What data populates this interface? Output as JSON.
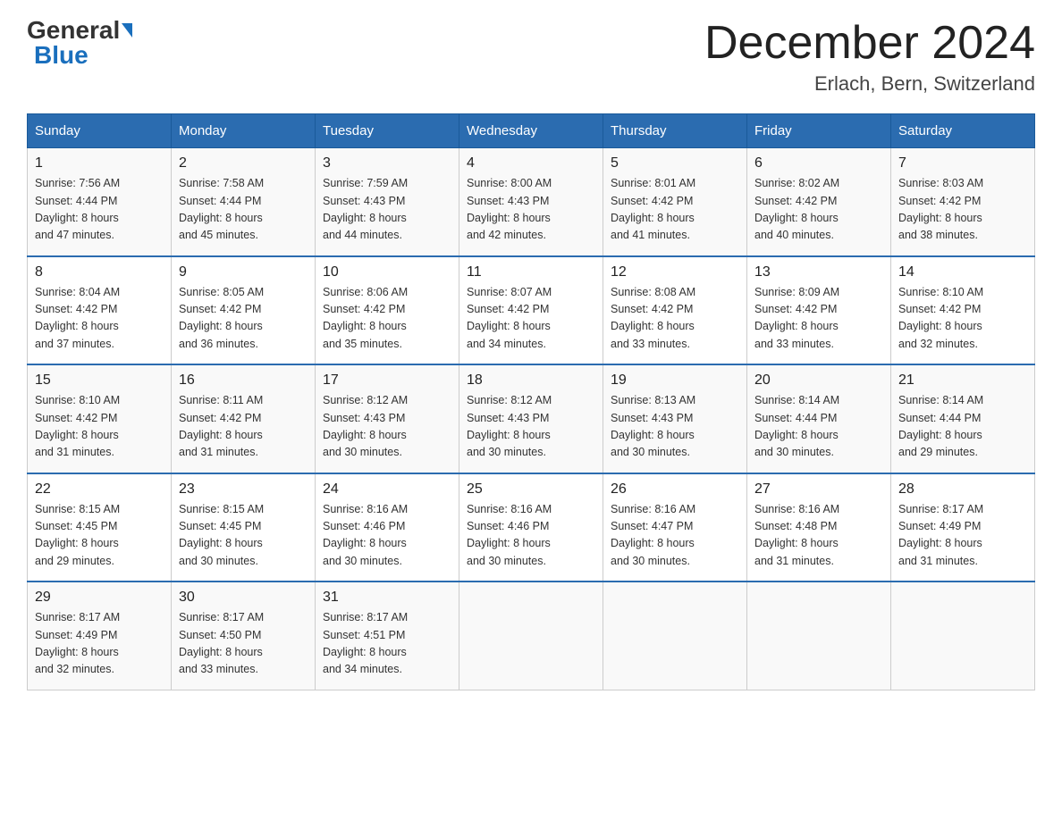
{
  "header": {
    "logo_general": "General",
    "logo_blue": "Blue",
    "month_title": "December 2024",
    "location": "Erlach, Bern, Switzerland"
  },
  "days_of_week": [
    "Sunday",
    "Monday",
    "Tuesday",
    "Wednesday",
    "Thursday",
    "Friday",
    "Saturday"
  ],
  "weeks": [
    [
      {
        "day": "1",
        "sunrise": "7:56 AM",
        "sunset": "4:44 PM",
        "daylight": "8 hours and 47 minutes."
      },
      {
        "day": "2",
        "sunrise": "7:58 AM",
        "sunset": "4:44 PM",
        "daylight": "8 hours and 45 minutes."
      },
      {
        "day": "3",
        "sunrise": "7:59 AM",
        "sunset": "4:43 PM",
        "daylight": "8 hours and 44 minutes."
      },
      {
        "day": "4",
        "sunrise": "8:00 AM",
        "sunset": "4:43 PM",
        "daylight": "8 hours and 42 minutes."
      },
      {
        "day": "5",
        "sunrise": "8:01 AM",
        "sunset": "4:42 PM",
        "daylight": "8 hours and 41 minutes."
      },
      {
        "day": "6",
        "sunrise": "8:02 AM",
        "sunset": "4:42 PM",
        "daylight": "8 hours and 40 minutes."
      },
      {
        "day": "7",
        "sunrise": "8:03 AM",
        "sunset": "4:42 PM",
        "daylight": "8 hours and 38 minutes."
      }
    ],
    [
      {
        "day": "8",
        "sunrise": "8:04 AM",
        "sunset": "4:42 PM",
        "daylight": "8 hours and 37 minutes."
      },
      {
        "day": "9",
        "sunrise": "8:05 AM",
        "sunset": "4:42 PM",
        "daylight": "8 hours and 36 minutes."
      },
      {
        "day": "10",
        "sunrise": "8:06 AM",
        "sunset": "4:42 PM",
        "daylight": "8 hours and 35 minutes."
      },
      {
        "day": "11",
        "sunrise": "8:07 AM",
        "sunset": "4:42 PM",
        "daylight": "8 hours and 34 minutes."
      },
      {
        "day": "12",
        "sunrise": "8:08 AM",
        "sunset": "4:42 PM",
        "daylight": "8 hours and 33 minutes."
      },
      {
        "day": "13",
        "sunrise": "8:09 AM",
        "sunset": "4:42 PM",
        "daylight": "8 hours and 33 minutes."
      },
      {
        "day": "14",
        "sunrise": "8:10 AM",
        "sunset": "4:42 PM",
        "daylight": "8 hours and 32 minutes."
      }
    ],
    [
      {
        "day": "15",
        "sunrise": "8:10 AM",
        "sunset": "4:42 PM",
        "daylight": "8 hours and 31 minutes."
      },
      {
        "day": "16",
        "sunrise": "8:11 AM",
        "sunset": "4:42 PM",
        "daylight": "8 hours and 31 minutes."
      },
      {
        "day": "17",
        "sunrise": "8:12 AM",
        "sunset": "4:43 PM",
        "daylight": "8 hours and 30 minutes."
      },
      {
        "day": "18",
        "sunrise": "8:12 AM",
        "sunset": "4:43 PM",
        "daylight": "8 hours and 30 minutes."
      },
      {
        "day": "19",
        "sunrise": "8:13 AM",
        "sunset": "4:43 PM",
        "daylight": "8 hours and 30 minutes."
      },
      {
        "day": "20",
        "sunrise": "8:14 AM",
        "sunset": "4:44 PM",
        "daylight": "8 hours and 30 minutes."
      },
      {
        "day": "21",
        "sunrise": "8:14 AM",
        "sunset": "4:44 PM",
        "daylight": "8 hours and 29 minutes."
      }
    ],
    [
      {
        "day": "22",
        "sunrise": "8:15 AM",
        "sunset": "4:45 PM",
        "daylight": "8 hours and 29 minutes."
      },
      {
        "day": "23",
        "sunrise": "8:15 AM",
        "sunset": "4:45 PM",
        "daylight": "8 hours and 30 minutes."
      },
      {
        "day": "24",
        "sunrise": "8:16 AM",
        "sunset": "4:46 PM",
        "daylight": "8 hours and 30 minutes."
      },
      {
        "day": "25",
        "sunrise": "8:16 AM",
        "sunset": "4:46 PM",
        "daylight": "8 hours and 30 minutes."
      },
      {
        "day": "26",
        "sunrise": "8:16 AM",
        "sunset": "4:47 PM",
        "daylight": "8 hours and 30 minutes."
      },
      {
        "day": "27",
        "sunrise": "8:16 AM",
        "sunset": "4:48 PM",
        "daylight": "8 hours and 31 minutes."
      },
      {
        "day": "28",
        "sunrise": "8:17 AM",
        "sunset": "4:49 PM",
        "daylight": "8 hours and 31 minutes."
      }
    ],
    [
      {
        "day": "29",
        "sunrise": "8:17 AM",
        "sunset": "4:49 PM",
        "daylight": "8 hours and 32 minutes."
      },
      {
        "day": "30",
        "sunrise": "8:17 AM",
        "sunset": "4:50 PM",
        "daylight": "8 hours and 33 minutes."
      },
      {
        "day": "31",
        "sunrise": "8:17 AM",
        "sunset": "4:51 PM",
        "daylight": "8 hours and 34 minutes."
      },
      null,
      null,
      null,
      null
    ]
  ],
  "labels": {
    "sunrise": "Sunrise:",
    "sunset": "Sunset:",
    "daylight": "Daylight:"
  }
}
